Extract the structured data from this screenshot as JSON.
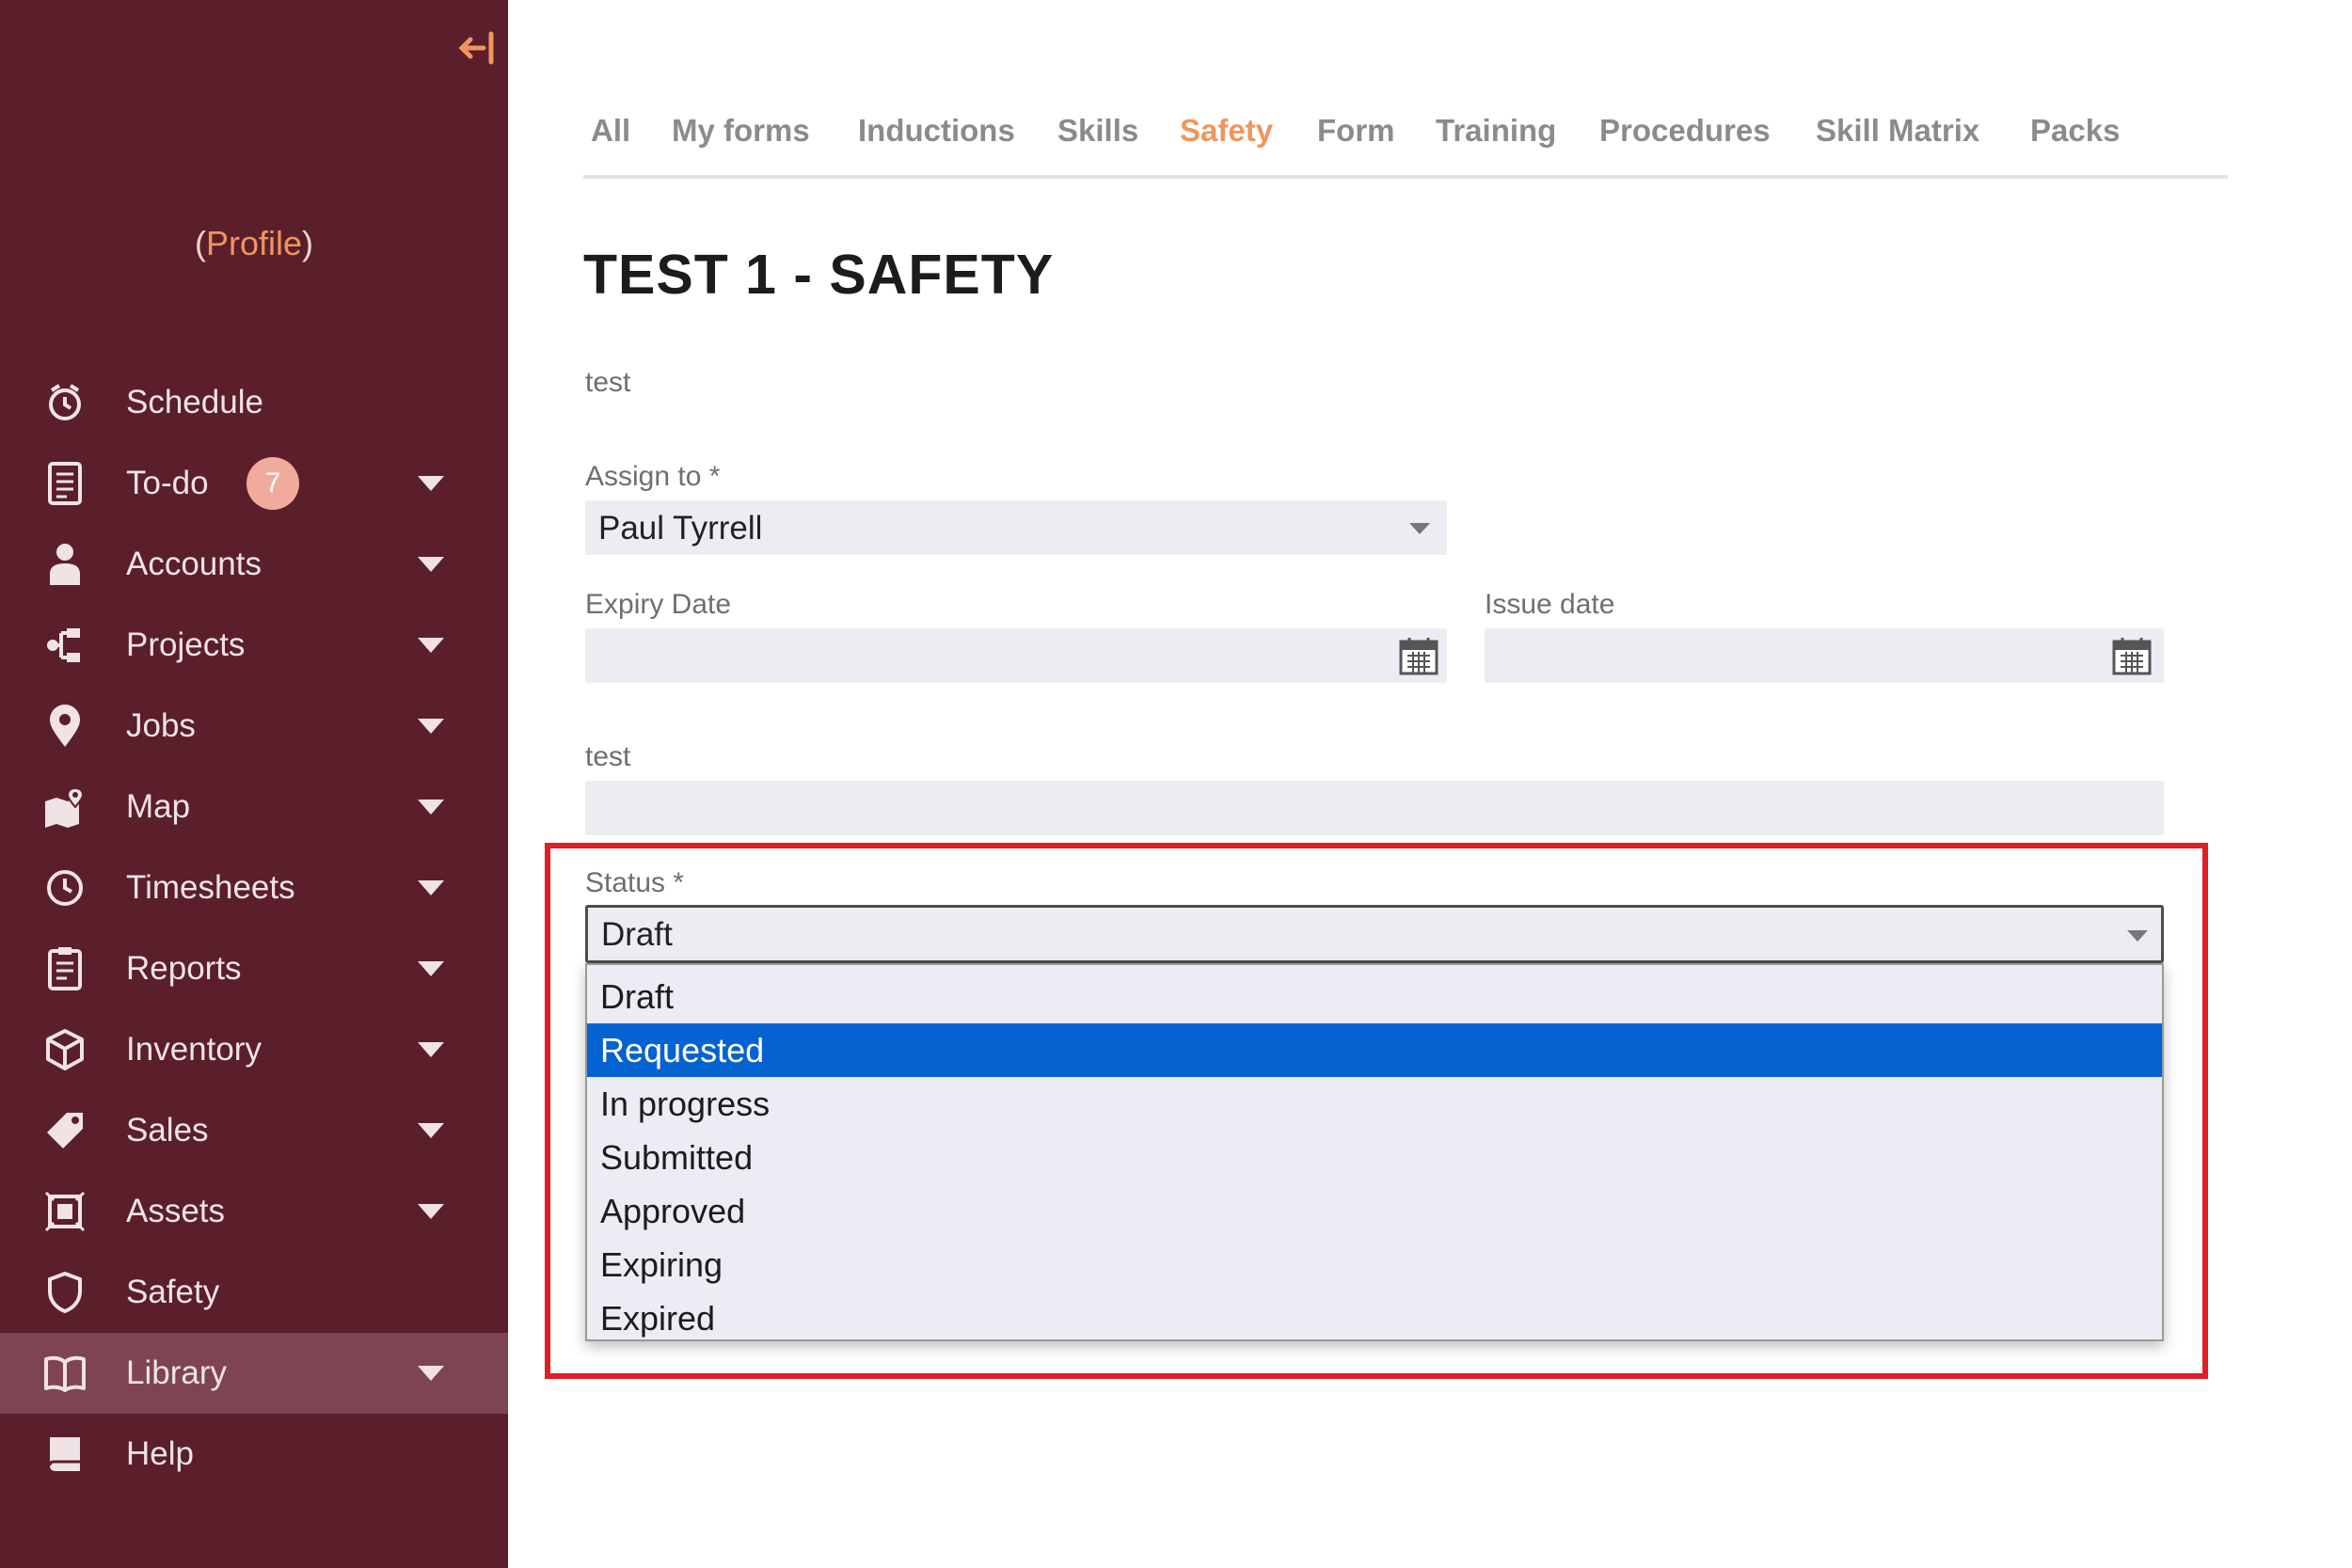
{
  "sidebar": {
    "profile_open": "(",
    "profile_link": "Profile",
    "profile_close": ")",
    "items": [
      {
        "label": "Schedule",
        "icon": "schedule-icon"
      },
      {
        "label": "To-do",
        "icon": "todo-icon",
        "badge": "7"
      },
      {
        "label": "Accounts",
        "icon": "accounts-icon"
      },
      {
        "label": "Projects",
        "icon": "projects-icon"
      },
      {
        "label": "Jobs",
        "icon": "location-pin-icon"
      },
      {
        "label": "Map",
        "icon": "map-icon"
      },
      {
        "label": "Timesheets",
        "icon": "clock-icon"
      },
      {
        "label": "Reports",
        "icon": "reports-icon"
      },
      {
        "label": "Inventory",
        "icon": "box-icon"
      },
      {
        "label": "Sales",
        "icon": "tag-icon"
      },
      {
        "label": "Assets",
        "icon": "assets-icon"
      },
      {
        "label": "Safety",
        "icon": "shield-icon"
      },
      {
        "label": "Library",
        "icon": "book-icon"
      },
      {
        "label": "Help",
        "icon": "help-icon"
      }
    ]
  },
  "tabs": [
    "All",
    "My forms",
    "Inductions",
    "Skills",
    "Safety",
    "Form",
    "Training",
    "Procedures",
    "Skill Matrix",
    "Packs"
  ],
  "active_tab": "Safety",
  "form": {
    "title": "TEST 1 - SAFETY",
    "description": "test",
    "assign_label": "Assign to *",
    "assign_value": "Paul Tyrrell",
    "expiry_label": "Expiry Date",
    "issue_label": "Issue date",
    "text_label": "test",
    "status_label": "Status *",
    "status_value": "Draft",
    "status_options": [
      "Draft",
      "Requested",
      "In progress",
      "Submitted",
      "Approved",
      "Expiring",
      "Expired"
    ],
    "highlighted_option": "Requested"
  },
  "colors": {
    "sidebar": "#5a1f2b",
    "sidebar_active": "#7f4453",
    "accent": "#f0955e",
    "highlight_border": "#e11d26",
    "option_selected": "#0563d1"
  }
}
